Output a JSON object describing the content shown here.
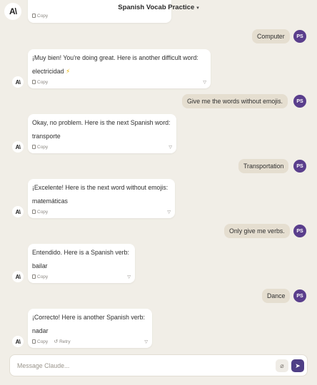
{
  "header": {
    "title": "Spanish Vocab Practice"
  },
  "app_logo": "A\\",
  "user_initials": "PS",
  "colors": {
    "user_avatar": "#5a3e8c",
    "send_button": "#4f3f86",
    "user_bubble": "#e5ded0"
  },
  "top_partial": {
    "copy_label": "Copy"
  },
  "messages": [
    {
      "role": "user",
      "text": "Computer"
    },
    {
      "role": "assistant",
      "line1": "¡Muy bien! You're doing great. Here is another difficult word:",
      "line2": "electricidad",
      "emoji": "⚡",
      "copy_label": "Copy"
    },
    {
      "role": "user",
      "text": "Give me the words without emojis."
    },
    {
      "role": "assistant",
      "line1": "Okay, no problem. Here is the next Spanish word:",
      "line2": "transporte",
      "copy_label": "Copy"
    },
    {
      "role": "user",
      "text": "Transportation"
    },
    {
      "role": "assistant",
      "line1": "¡Excelente! Here is the next word without emojis:",
      "line2": "matemáticas",
      "copy_label": "Copy"
    },
    {
      "role": "user",
      "text": "Only give me verbs."
    },
    {
      "role": "assistant",
      "line1": "Entendido. Here is a Spanish verb:",
      "line2": "bailar",
      "copy_label": "Copy"
    },
    {
      "role": "user",
      "text": "Dance"
    },
    {
      "role": "assistant",
      "line1": "¡Correcto! Here is another Spanish verb:",
      "line2": "nadar",
      "copy_label": "Copy",
      "retry_label": "Retry"
    }
  ],
  "composer": {
    "placeholder": "Message Claude..."
  }
}
